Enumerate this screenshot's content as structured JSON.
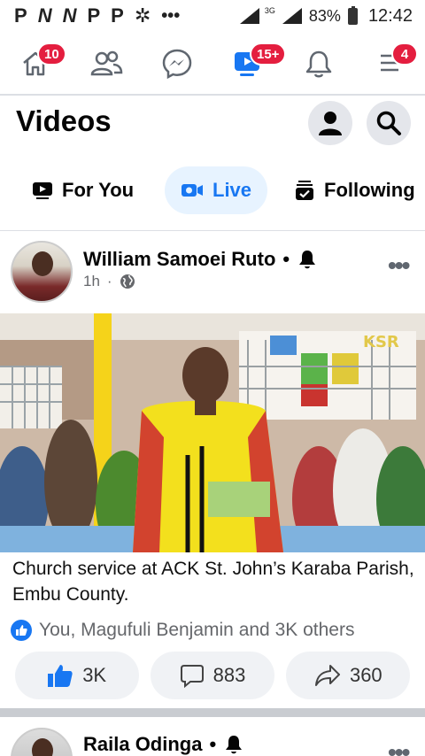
{
  "status_bar": {
    "app_icons": [
      "P",
      "N",
      "N",
      "P",
      "P"
    ],
    "network": "3G",
    "battery": "83%",
    "time": "12:42"
  },
  "nav": {
    "home_badge": "10",
    "video_badge": "15+",
    "menu_badge": "4"
  },
  "page": {
    "title": "Videos"
  },
  "tabs": [
    {
      "label": "For You"
    },
    {
      "label": "Live"
    },
    {
      "label": "Following"
    }
  ],
  "posts": [
    {
      "author": "William Samoei Ruto",
      "time": "1h",
      "caption": "Church service at ACK St. John’s Karaba Parish, Embu County.",
      "reactions": "You, Magufuli Benjamin and 3K others",
      "likes": "3K",
      "comments": "883",
      "shares": "360"
    },
    {
      "author": "Raila Odinga"
    }
  ],
  "colors": {
    "accent": "#1877f2",
    "badge": "#e41e3f",
    "active_tab_bg": "#e7f3ff"
  }
}
